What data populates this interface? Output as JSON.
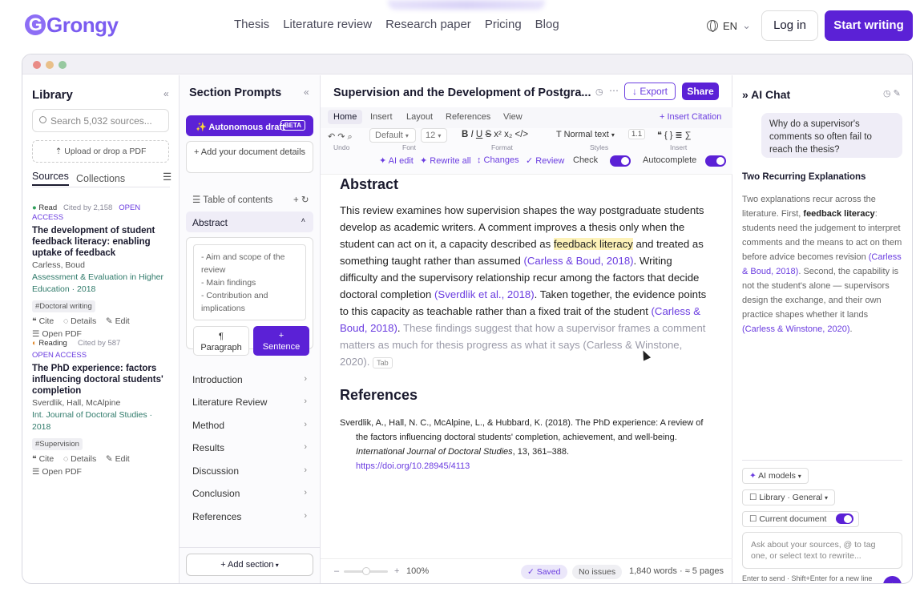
{
  "header": {
    "logo": "Grongy",
    "nav": [
      "Thesis",
      "Literature review",
      "Research paper",
      "Pricing",
      "Blog"
    ],
    "lang": "EN",
    "login": "Log in",
    "start": "Start writing"
  },
  "library": {
    "title": "Library",
    "collapse": "«",
    "search_placeholder": "Search 5,032 sources...",
    "upload": "Upload or drop a PDF",
    "tabs": [
      "Sources",
      "Collections"
    ],
    "sources": [
      {
        "status": "Read",
        "cited": "Cited by 2,158",
        "access": "OPEN ACCESS",
        "title": "The development of student feedback literacy: enabling uptake of feedback",
        "authors": "Carless, Boud",
        "venue": "Assessment & Evaluation in Higher Education · 2018",
        "tag": "#Doctoral writing",
        "actions": [
          "Cite",
          "Details",
          "Edit"
        ],
        "open": "Open PDF"
      },
      {
        "status": "Reading",
        "cited": "Cited by 587",
        "access": "OPEN ACCESS",
        "title": "The PhD experience: factors influencing doctoral students' completion",
        "authors": "Sverdlik, Hall, McAlpine",
        "venue": "Int. Journal of Doctoral Studies · 2018",
        "tag": "#Supervision",
        "actions": [
          "Cite",
          "Details",
          "Edit"
        ],
        "open": "Open PDF"
      }
    ]
  },
  "sections": {
    "title": "Section Prompts",
    "collapse": "«",
    "autonomous": "Autonomous draft",
    "beta": "BETA",
    "add_details": "+ Add your document details",
    "toc": "Table of contents",
    "current": "Abstract",
    "outline": [
      "- Aim and scope of the review",
      "- Main findings",
      "- Contribution and implications"
    ],
    "paragraph_btn": "Paragraph",
    "sentence_btn": "Sentence",
    "items": [
      "Introduction",
      "Literature Review",
      "Method",
      "Results",
      "Discussion",
      "Conclusion",
      "References"
    ],
    "add_section": "+ Add section"
  },
  "editor": {
    "title": "Supervision and the Development of Postgra...",
    "export": "Export",
    "share": "Share",
    "tabs": [
      "Home",
      "Insert",
      "Layout",
      "References",
      "View"
    ],
    "insert_citation": "+ Insert Citation",
    "toolbar": {
      "undo": "Undo",
      "font": "Default",
      "font_label": "Font",
      "size": "12",
      "format_label": "Format",
      "style": "Normal text",
      "styles_label": "Styles",
      "line": "1.1",
      "insert_label": "Insert"
    },
    "actions": [
      "✦ AI edit",
      "✦ Rewrite all",
      "↕ Changes",
      "✓ Review"
    ],
    "check": "Check",
    "autocomplete": "Autocomplete",
    "abstract_heading": "Abstract",
    "p1": "This review examines how supervision shapes the way postgraduate students develop as academic writers. A comment improves a thesis only when the student can act on it, a capacity described as ",
    "p1_hl": "feedback literacy",
    "p2": " and treated as something taught rather than assumed ",
    "c1": "(Carless & Boud, 2018)",
    "p3": ". Writing difficulty and the supervisory relationship recur among the factors that decide doctoral completion ",
    "c2": "(Sverdlik et al., 2018)",
    "p4": ". Taken together, the evidence points to this capacity as teachable rather than a fixed trait of the student ",
    "c3": "(Carless & Boud, 2018)",
    "p5": ". ",
    "ghost": "These findings suggest that how a supervisor frames a comment matters as much for thesis progress as what it says (Carless & Winstone, 2020).",
    "tab_key": "Tab",
    "refs_heading": "References",
    "ref_text": "Sverdlik, A., Hall, N. C., McAlpine, L., & Hubbard, K. (2018). The PhD experience: A review of the factors influencing doctoral students' completion, achievement, and well-being. ",
    "ref_journal": "International Journal of Doctoral Studies",
    "ref_tail": ", 13, 361–388.",
    "ref_doi": "https://doi.org/10.28945/4113",
    "zoom": "100%",
    "saved": "✓ Saved",
    "issues": "No issues",
    "words": "1,840 words · ≈ 5 pages"
  },
  "ai": {
    "title": "» AI Chat",
    "question": "Why do a supervisor's comments so often fail to reach the thesis?",
    "answer_title": "Two Recurring Explanations",
    "a1": "Two explanations recur across the literature. First, ",
    "a1b": "feedback literacy",
    "a2": ": students need the judgement to interpret comments and the means to act on them before advice becomes revision ",
    "ac1": "(Carless & Boud, 2018)",
    "a3": ". Second, the capability is not the student's alone — supervisors design the exchange, and their own practice shapes whether it lands ",
    "ac2": "(Carless & Winstone, 2020)",
    "a4": ".",
    "models": "AI models",
    "library": "Library · General",
    "current_doc": "Current document",
    "placeholder": "Ask about your sources, @ to tag one, or select text to rewrite...",
    "hint": "Enter to send · Shift+Enter for a new line"
  },
  "colors": {
    "accent": "#5b21d6",
    "cite": "#6b3de0",
    "highlight": "#fdf2b8"
  }
}
